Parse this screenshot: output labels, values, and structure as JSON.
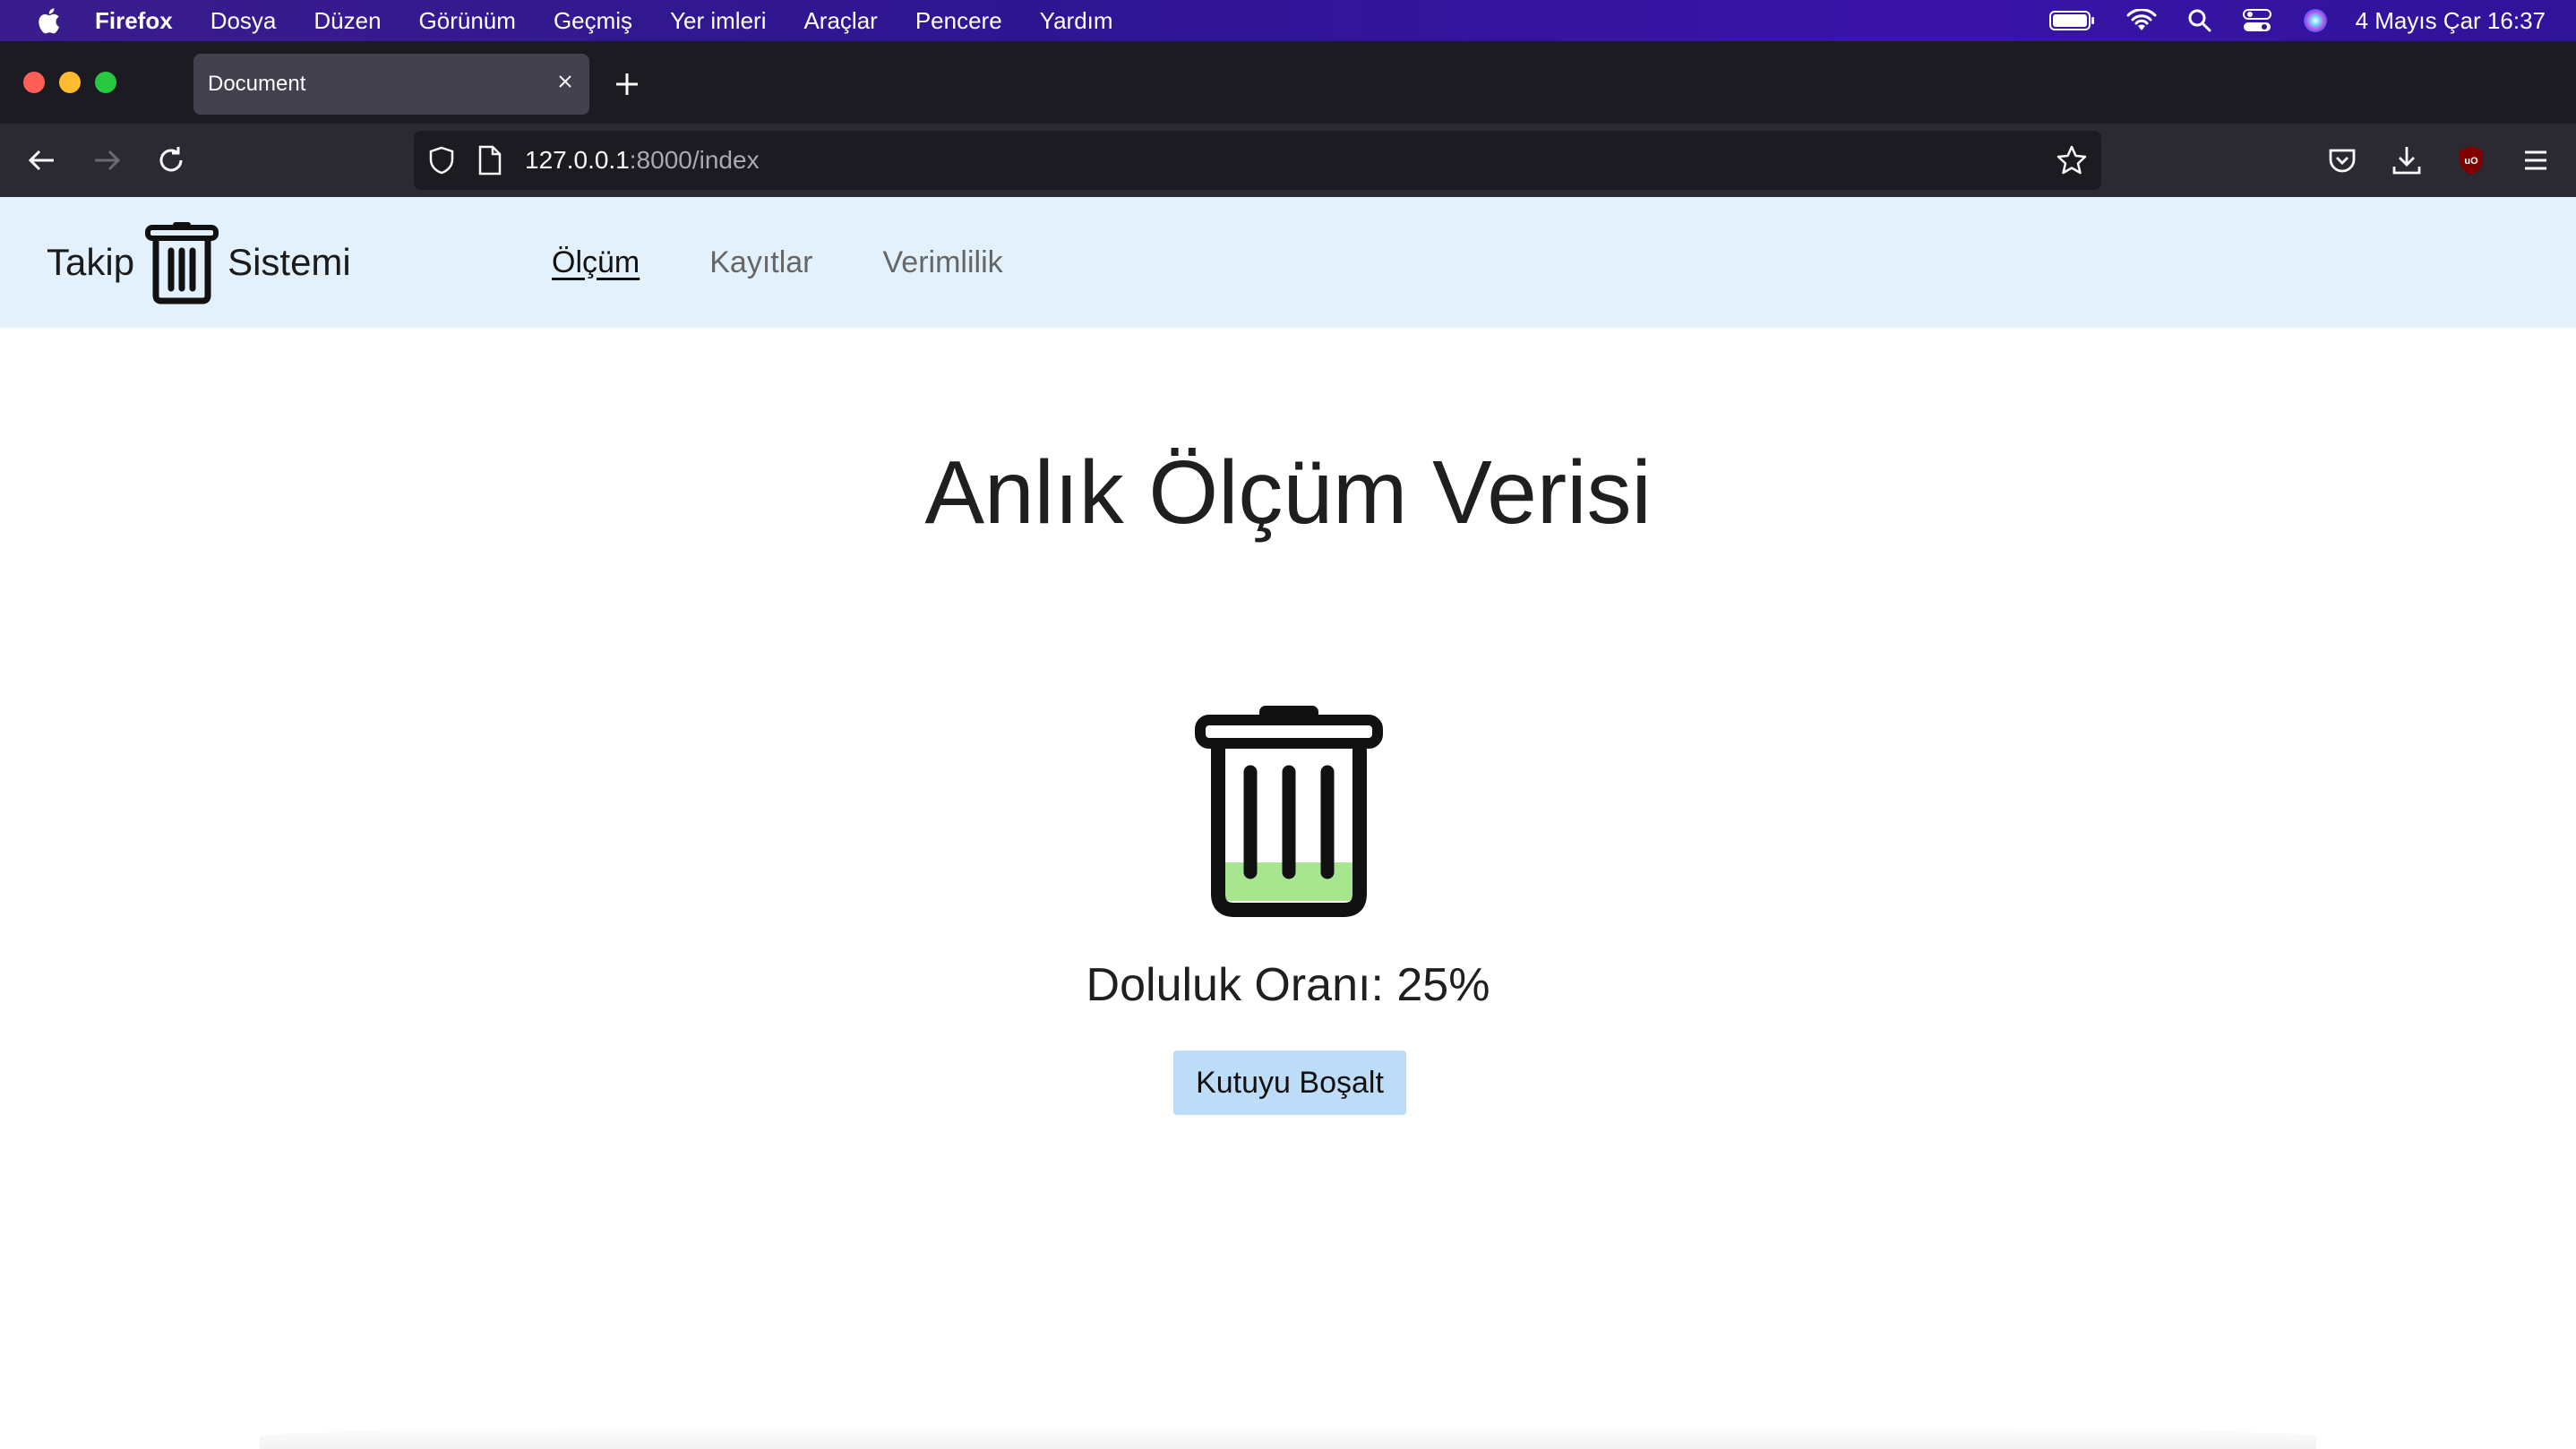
{
  "menubar": {
    "app_name": "Firefox",
    "items": [
      "Dosya",
      "Düzen",
      "Görünüm",
      "Geçmiş",
      "Yer imleri",
      "Araçlar",
      "Pencere",
      "Yardım"
    ],
    "clock": "4 Mayıs Çar  16:37"
  },
  "browser": {
    "tab_title": "Document",
    "url_host": "127.0.0.1",
    "url_rest": ":8000/index"
  },
  "site": {
    "brand_left": "Takip",
    "brand_right": "Sistemi",
    "nav": [
      "Ölçüm",
      "Kayıtlar",
      "Verimlilik"
    ],
    "active_nav": "Ölçüm"
  },
  "main": {
    "title": "Anlık Ölçüm Verisi",
    "fill_label": "Doluluk Oranı: 25%",
    "fill_ratio": 0.25,
    "fill_color": "#a8e58f",
    "button_label": "Kutuyu Boşalt"
  },
  "colors": {
    "menubar": "#2d1591",
    "header_bg": "#e3f1fc",
    "button_bg": "#bcdcf7"
  }
}
